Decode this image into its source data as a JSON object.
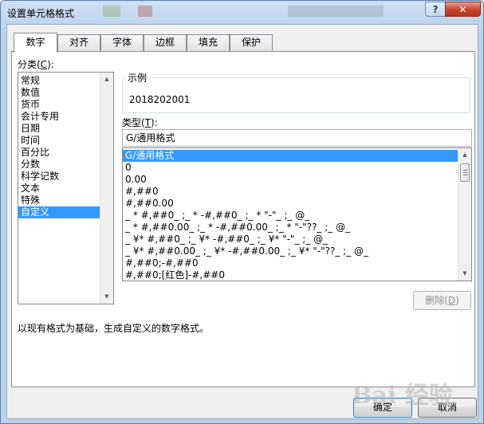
{
  "window": {
    "title": "设置单元格格式",
    "help_label": "?",
    "close_label": "✕"
  },
  "tabs": [
    {
      "label": "数字",
      "active": true
    },
    {
      "label": "对齐"
    },
    {
      "label": "字体"
    },
    {
      "label": "边框"
    },
    {
      "label": "填充"
    },
    {
      "label": "保护"
    }
  ],
  "category": {
    "label_prefix": "分类(",
    "label_key": "C",
    "label_suffix": "):",
    "items": [
      "常规",
      "数值",
      "货币",
      "会计专用",
      "日期",
      "时间",
      "百分比",
      "分数",
      "科学记数",
      "文本",
      "特殊",
      "自定义"
    ],
    "selected_index": 11
  },
  "sample": {
    "label": "示例",
    "value": "2018202001"
  },
  "type": {
    "label_prefix": "类型(",
    "label_key": "T",
    "label_suffix": "):",
    "input_value": "G/通用格式",
    "items": [
      "G/通用格式",
      "0",
      "0.00",
      "#,##0",
      "#,##0.00",
      "_ * #,##0_ ;_ * -#,##0_ ;_ * \"-\"_ ;_ @_",
      "_ * #,##0.00_ ;_ * -#,##0.00_ ;_ * \"-\"??_ ;_ @_",
      "_ ¥* #,##0_ ;_ ¥* -#,##0_ ;_ ¥* \"-\"_ ;_ @_",
      "_ ¥* #,##0.00_ ;_ ¥* -#,##0.00_ ;_ ¥* \"-\"??_ ;_ @_",
      "#,##0;-#,##0",
      "#,##0;[红色]-#,##0"
    ],
    "selected_index": 0
  },
  "delete_button": {
    "label_prefix": "删除(",
    "label_key": "D",
    "label_suffix": ")"
  },
  "description": "以现有格式为基础，生成自定义的数字格式。",
  "ok_label": "确定",
  "cancel_label": "取消",
  "watermark": "Bai 经验",
  "colors": {
    "selection": "#3399ff",
    "close_button": "#c4452c",
    "title_bar": "#b9d1ea"
  }
}
